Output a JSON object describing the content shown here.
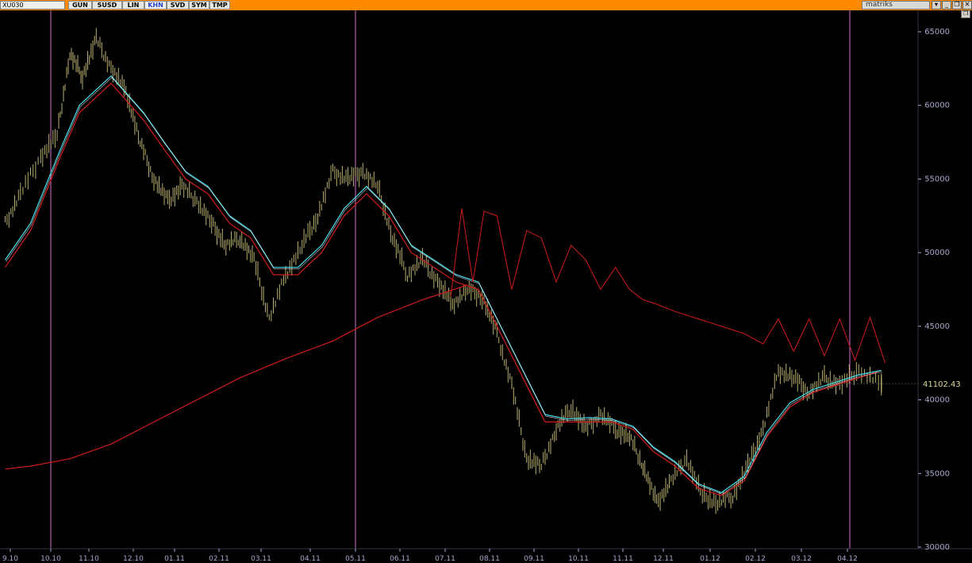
{
  "toolbar": {
    "symbol": "XU030",
    "buttons": [
      {
        "label": "GUN",
        "active": false
      },
      {
        "label": "SUSD",
        "active": false
      },
      {
        "label": "LIN",
        "active": false
      },
      {
        "label": "KHN",
        "active": true
      },
      {
        "label": "SVD",
        "active": false
      },
      {
        "label": "SYM",
        "active": false
      },
      {
        "label": "TMP",
        "active": false
      }
    ],
    "brand": "matriks",
    "window_buttons": [
      "▾",
      "_",
      "❐",
      "✕"
    ],
    "side_button": "❐"
  },
  "colors": {
    "background": "#000000",
    "price": "#b8b070",
    "ma_red": "#d01c1c",
    "ma_cyan": "#48e0f0",
    "ma_white": "#ffffff",
    "marker_line": "#d070d0",
    "axis_text": "#a8a8d0",
    "last_value_text": "#d8d8a0"
  },
  "chart_data": {
    "type": "line",
    "title": "",
    "xlabel": "",
    "ylabel": "",
    "ylim": [
      30000,
      65000
    ],
    "y_ticks": [
      65000,
      60000,
      55000,
      50000,
      45000,
      40000,
      35000,
      30000
    ],
    "x_ticks": [
      "9.10",
      "10.10",
      "11.10",
      "12.10",
      "01.11",
      "02.11",
      "03.11",
      "04.11",
      "05.11",
      "06.11",
      "07.11",
      "08.11",
      "09.11",
      "10.11",
      "11.11",
      "12.11",
      "01.12",
      "02.12",
      "03.12",
      "04.12"
    ],
    "last_value": "41102.43",
    "last_value_num": 41102.43,
    "vertical_markers": [
      "10.10",
      "05.11",
      "04.12"
    ],
    "series": [
      {
        "key": "price",
        "values": [
          [
            "8.10",
            52000
          ],
          [
            "9.10",
            54000
          ],
          [
            "9.10",
            56500
          ],
          [
            "10.10",
            58000
          ],
          [
            "10.10",
            63500
          ],
          [
            "10.10",
            62000
          ],
          [
            "11.10",
            64500
          ],
          [
            "11.10",
            62500
          ],
          [
            "11.10",
            61000
          ],
          [
            "12.10",
            57500
          ],
          [
            "12.10",
            55000
          ],
          [
            "12.10",
            53500
          ],
          [
            "01.11",
            54500
          ],
          [
            "01.11",
            53500
          ],
          [
            "01.11",
            52000
          ],
          [
            "02.11",
            50500
          ],
          [
            "02.11",
            51000
          ],
          [
            "02.11",
            49500
          ],
          [
            "03.11",
            45500
          ],
          [
            "03.11",
            48500
          ],
          [
            "03.11",
            50500
          ],
          [
            "04.11",
            52500
          ],
          [
            "04.11",
            55500
          ],
          [
            "04.11",
            55000
          ],
          [
            "05.11",
            55500
          ],
          [
            "05.11",
            54500
          ],
          [
            "05.11",
            51000
          ],
          [
            "06.11",
            48500
          ],
          [
            "06.11",
            49500
          ],
          [
            "06.11",
            48000
          ],
          [
            "07.11",
            46500
          ],
          [
            "07.11",
            47500
          ],
          [
            "07.11",
            47000
          ],
          [
            "08.11",
            44500
          ],
          [
            "08.11",
            41000
          ],
          [
            "08.11",
            36000
          ],
          [
            "09.11",
            35500
          ],
          [
            "09.11",
            38000
          ],
          [
            "09.11",
            39500
          ],
          [
            "10.11",
            38000
          ],
          [
            "10.11",
            39000
          ],
          [
            "10.11",
            38000
          ],
          [
            "11.11",
            37500
          ],
          [
            "11.11",
            35500
          ],
          [
            "11.11",
            33000
          ],
          [
            "12.11",
            34500
          ],
          [
            "12.11",
            36000
          ],
          [
            "12.11",
            33500
          ],
          [
            "01.12",
            33000
          ],
          [
            "01.12",
            33500
          ],
          [
            "01.12",
            35500
          ],
          [
            "02.12",
            38000
          ],
          [
            "02.12",
            42000
          ],
          [
            "02.12",
            41500
          ],
          [
            "03.12",
            40500
          ],
          [
            "03.12",
            41500
          ],
          [
            "03.12",
            41000
          ],
          [
            "04.12",
            42000
          ],
          [
            "04.12",
            41102.43
          ]
        ]
      },
      {
        "key": "ma_red",
        "values": [
          [
            "8.10",
            49000
          ],
          [
            "9.10",
            51500
          ],
          [
            "10.10",
            56500
          ],
          [
            "10.10",
            59500
          ],
          [
            "11.10",
            61500
          ],
          [
            "12.10",
            59000
          ],
          [
            "12.10",
            57000
          ],
          [
            "01.11",
            55000
          ],
          [
            "01.11",
            54000
          ],
          [
            "02.11",
            52000
          ],
          [
            "02.11",
            51000
          ],
          [
            "03.11",
            48500
          ],
          [
            "03.11",
            48500
          ],
          [
            "04.11",
            50000
          ],
          [
            "04.11",
            52500
          ],
          [
            "05.11",
            54000
          ],
          [
            "05.11",
            52500
          ],
          [
            "06.11",
            50000
          ],
          [
            "06.11",
            49000
          ],
          [
            "07.11",
            48000
          ],
          [
            "07.11",
            47500
          ],
          [
            "08.11",
            44500
          ],
          [
            "08.11",
            41500
          ],
          [
            "09.11",
            38500
          ],
          [
            "09.11",
            38500
          ],
          [
            "10.11",
            38500
          ],
          [
            "10.11",
            38500
          ],
          [
            "11.11",
            38000
          ],
          [
            "11.11",
            36500
          ],
          [
            "12.11",
            35500
          ],
          [
            "12.11",
            34000
          ],
          [
            "01.12",
            33500
          ],
          [
            "01.12",
            34500
          ],
          [
            "02.12",
            37500
          ],
          [
            "02.12",
            39500
          ],
          [
            "03.12",
            40500
          ],
          [
            "03.12",
            41000
          ],
          [
            "04.12",
            41500
          ],
          [
            "04.12",
            42000
          ]
        ]
      },
      {
        "key": "ma_cyan",
        "values": [
          [
            "8.10",
            49500
          ],
          [
            "9.10",
            52000
          ],
          [
            "10.10",
            57000
          ],
          [
            "10.10",
            60000
          ],
          [
            "11.10",
            62000
          ],
          [
            "12.10",
            59500
          ],
          [
            "12.10",
            57500
          ],
          [
            "01.11",
            55500
          ],
          [
            "01.11",
            54500
          ],
          [
            "02.11",
            52500
          ],
          [
            "02.11",
            51500
          ],
          [
            "03.11",
            49000
          ],
          [
            "03.11",
            49000
          ],
          [
            "04.11",
            50500
          ],
          [
            "04.11",
            53000
          ],
          [
            "05.11",
            54500
          ],
          [
            "05.11",
            53000
          ],
          [
            "06.11",
            50500
          ],
          [
            "06.11",
            49500
          ],
          [
            "07.11",
            48500
          ],
          [
            "07.11",
            48000
          ],
          [
            "08.11",
            45000
          ],
          [
            "08.11",
            42000
          ],
          [
            "09.11",
            39000
          ],
          [
            "09.11",
            38700
          ],
          [
            "10.11",
            38800
          ],
          [
            "10.11",
            38700
          ],
          [
            "11.11",
            38200
          ],
          [
            "11.11",
            36800
          ],
          [
            "12.11",
            35800
          ],
          [
            "12.11",
            34300
          ],
          [
            "01.12",
            33700
          ],
          [
            "01.12",
            34800
          ],
          [
            "02.12",
            37800
          ],
          [
            "02.12",
            39800
          ],
          [
            "03.12",
            40700
          ],
          [
            "03.12",
            41200
          ],
          [
            "04.12",
            41700
          ],
          [
            "04.12",
            42000
          ]
        ]
      },
      {
        "key": "ma_long",
        "values": [
          [
            "8.10",
            35300
          ],
          [
            "9.10",
            35500
          ],
          [
            "10.10",
            36000
          ],
          [
            "11.10",
            37000
          ],
          [
            "12.10",
            38500
          ],
          [
            "01.11",
            40000
          ],
          [
            "02.11",
            41500
          ],
          [
            "03.11",
            42800
          ],
          [
            "04.11",
            44000
          ],
          [
            "05.11",
            45600
          ],
          [
            "06.11",
            46800
          ],
          [
            "07.11",
            47800
          ]
        ]
      },
      {
        "key": "ma_envelope",
        "values": [
          [
            "07.11",
            47000
          ],
          [
            "07.11",
            53000
          ],
          [
            "07.11",
            48000
          ],
          [
            "07.11",
            52800
          ],
          [
            "08.11",
            52500
          ],
          [
            "08.11",
            47500
          ],
          [
            "08.11",
            51500
          ],
          [
            "09.11",
            51000
          ],
          [
            "09.11",
            48000
          ],
          [
            "09.11",
            50500
          ],
          [
            "10.11",
            49500
          ],
          [
            "10.11",
            47500
          ],
          [
            "10.11",
            49000
          ],
          [
            "11.11",
            47500
          ],
          [
            "11.11",
            46800
          ],
          [
            "11.11",
            46500
          ],
          [
            "12.11",
            46000
          ],
          [
            "12.11",
            45500
          ],
          [
            "01.12",
            45000
          ],
          [
            "01.12",
            44500
          ],
          [
            "02.12",
            43800
          ],
          [
            "02.12",
            45500
          ],
          [
            "02.12",
            43300
          ],
          [
            "03.12",
            45500
          ],
          [
            "03.12",
            43000
          ],
          [
            "03.12",
            45500
          ],
          [
            "04.12",
            42700
          ],
          [
            "04.12",
            45600
          ],
          [
            "04.12",
            42500
          ]
        ]
      }
    ]
  }
}
